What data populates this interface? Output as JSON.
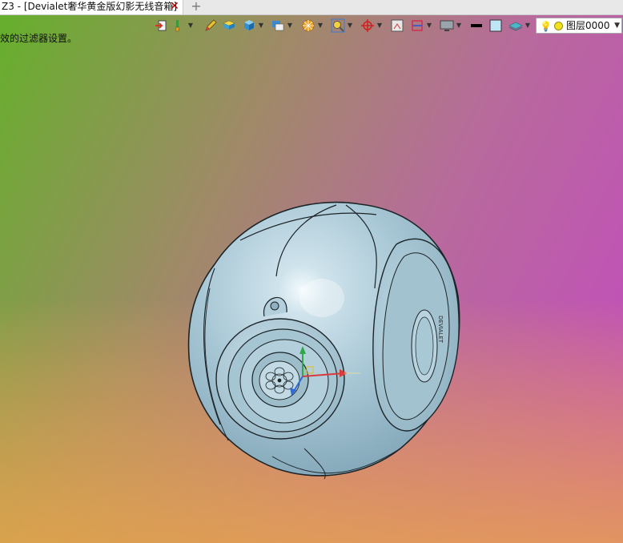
{
  "tab": {
    "title": "Z3 - [Devialet奢华黄金版幻影无线音箱]",
    "close_glyph": "✕",
    "add_glyph": "+"
  },
  "hint_text": "效的过滤器设置。",
  "toolbar": {
    "icons": [
      "import-arrow-icon",
      "brush-icon",
      "pencil-icon",
      "folder-icon",
      "cube-view-icon",
      "display-mode-icon",
      "render-sphere-icon",
      "zoom-fit-icon",
      "axis-triad-icon",
      "frame-icon",
      "section-icon",
      "monitor-icon",
      "line-weight-icon",
      "color-swatch-icon",
      "layer-stack-icon"
    ],
    "layer_selector": {
      "bulb_glyph": "💡",
      "value": "图层0000",
      "arrow_glyph": "▼"
    },
    "dropdown_glyph": "▼"
  },
  "colors": {
    "model_body": "#a9c8d6",
    "model_highlight": "#e6f3f8",
    "model_edge": "#1c2428",
    "axis_red": "#d83a3a",
    "axis_green": "#2ea84a",
    "axis_blue": "#2e6ad8"
  },
  "model": {
    "name": "devialet-phantom-speaker",
    "brand_mark": "DEVIALET"
  }
}
